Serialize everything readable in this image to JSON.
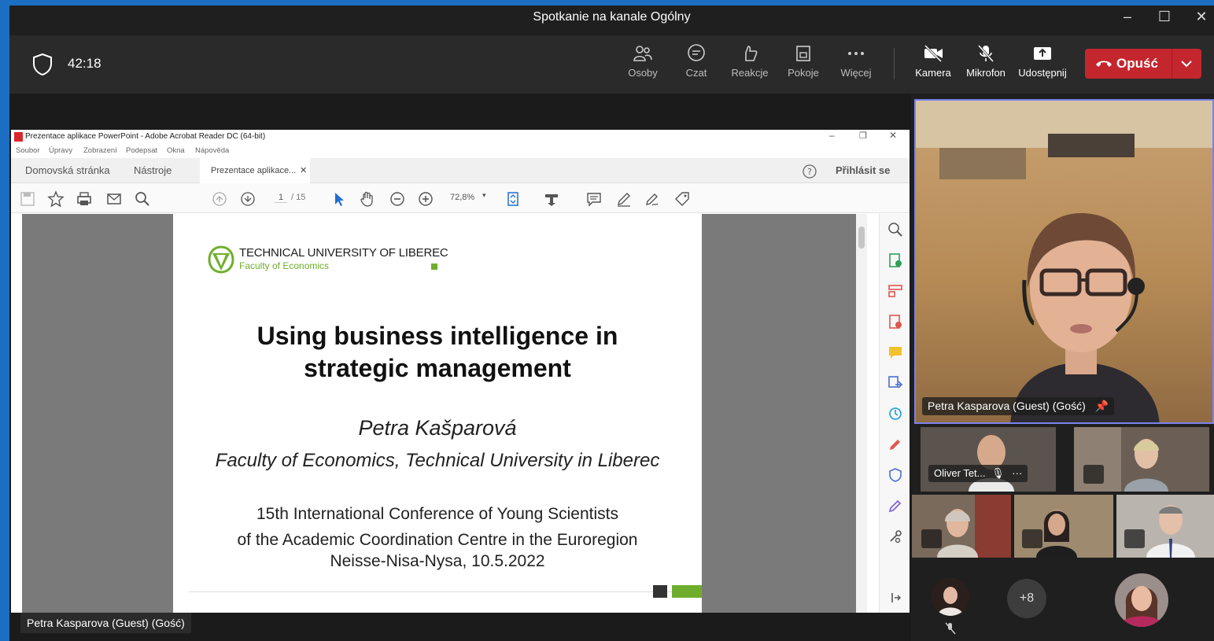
{
  "window": {
    "title": "Spotkanie na kanale Ogólny",
    "minimize": "–",
    "maximize": "☐",
    "close": "✕"
  },
  "toolbar": {
    "timer": "42:18",
    "buttons": [
      {
        "label": "Osoby",
        "icon": "people-icon"
      },
      {
        "label": "Czat",
        "icon": "chat-icon"
      },
      {
        "label": "Reakcje",
        "icon": "reactions-icon"
      },
      {
        "label": "Pokoje",
        "icon": "rooms-icon"
      },
      {
        "label": "Więcej",
        "icon": "more-icon"
      },
      {
        "label": "Kamera",
        "icon": "camera-off-icon"
      },
      {
        "label": "Mikrofon",
        "icon": "mic-off-icon"
      },
      {
        "label": "Udostępnij",
        "icon": "share-icon"
      }
    ],
    "leave_label": "Opuść"
  },
  "acrobat": {
    "title": "Prezentace aplikace PowerPoint - Adobe Acrobat Reader DC (64-bit)",
    "menu": [
      "Soubor",
      "Úpravy",
      "Zobrazení",
      "Podepsat",
      "Okna",
      "Nápověda"
    ],
    "tabs": [
      "Domovská stránka",
      "Nástroje"
    ],
    "active_tab": "Prezentace aplikace...",
    "login": "Přihlásit se",
    "page_current": "1",
    "page_total": "/ 15",
    "zoom": "72,8%"
  },
  "slide": {
    "university": "TECHNICAL UNIVERSITY OF LIBEREC",
    "faculty_small": "Faculty of Economics",
    "title_line1": "Using business intelligence in",
    "title_line2": "strategic management",
    "author": "Petra Kašparová",
    "affiliation": "Faculty of Economics, Technical University in Liberec",
    "conf_line1": "15th International Conference of Young Scientists",
    "conf_line2": "of the Academic Coordination Centre in the Euroregion",
    "conf_line3": "Neisse-Nisa-Nysa, 10.5.2022"
  },
  "participants": {
    "main_name": "Petra Kasparova (Guest) (Gość)",
    "tile_oliver": "Oliver Tet...",
    "overflow": "+8",
    "presenter": "Petra Kasparova (Guest) (Gość)"
  },
  "colors": {
    "frame_border": "#1b6ec2",
    "leave_button": "#c4262e",
    "active_speaker": "#7b83eb",
    "tul_green": "#6fae2c"
  }
}
